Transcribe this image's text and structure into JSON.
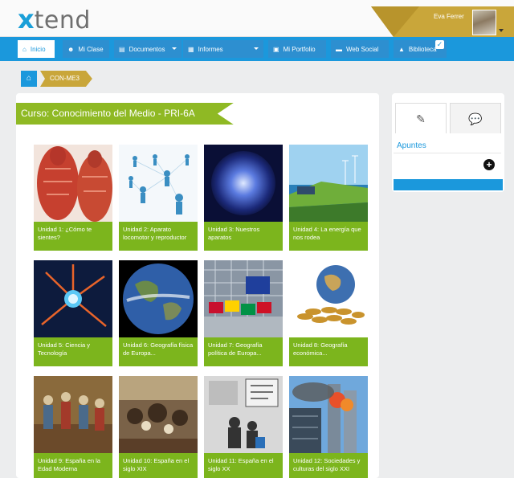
{
  "header": {
    "logo_x": "x",
    "logo_word": "tend",
    "user_name": "Eva Ferrer"
  },
  "nav": {
    "tabs": [
      {
        "label": "Inicio",
        "icon": "home-icon"
      },
      {
        "label": "Mi Clase",
        "icon": "users-icon"
      },
      {
        "label": "Documentos",
        "icon": "document-icon"
      },
      {
        "label": "Informes",
        "icon": "report-icon"
      },
      {
        "label": "Mi Portfolio",
        "icon": "portfolio-icon"
      },
      {
        "label": "Web Social",
        "icon": "folder-icon"
      },
      {
        "label": "Biblioteca",
        "icon": "library-icon"
      }
    ]
  },
  "breadcrumb": {
    "current": "CON-ME3"
  },
  "course": {
    "title": "Curso: Conocimiento del Medio - PRI-6A"
  },
  "units": [
    {
      "label": "Unidad 1: ¿Cómo te sientes?",
      "image": "anatomy-image"
    },
    {
      "label": "Unidad 2: Aparato locomotor y reproductor",
      "image": "network-people-image"
    },
    {
      "label": "Unidad 3: Nuestros aparatos",
      "image": "glow-sphere-image"
    },
    {
      "label": "Unidad 4: La energía que nos rodea",
      "image": "energy-landscape-image"
    },
    {
      "label": "Unidad 5: Ciencia y Tecnología",
      "image": "neuron-image"
    },
    {
      "label": "Unidad 6: Geografía física de Europa...",
      "image": "earth-image"
    },
    {
      "label": "Unidad 7: Geografía política de Europa...",
      "image": "flags-image"
    },
    {
      "label": "Unidad 8: Geografía económica...",
      "image": "globe-coins-image"
    },
    {
      "label": "Unidad 9: España en la Edad Moderna",
      "image": "painting-court-image"
    },
    {
      "label": "Unidad 10: España en el siglo XIX",
      "image": "painting-battle-image"
    },
    {
      "label": "Unidad 11: España en el siglo XX",
      "image": "franco-photo-image"
    },
    {
      "label": "Unidad 12: Sociedades y culturas del siglo XXI",
      "image": "twin-towers-image"
    }
  ],
  "side": {
    "notes_label": "Apuntes",
    "add_symbol": "+"
  },
  "colors": {
    "brand_blue": "#1b98dc",
    "brand_green": "#7cb51d",
    "gold": "#c9a63a"
  }
}
